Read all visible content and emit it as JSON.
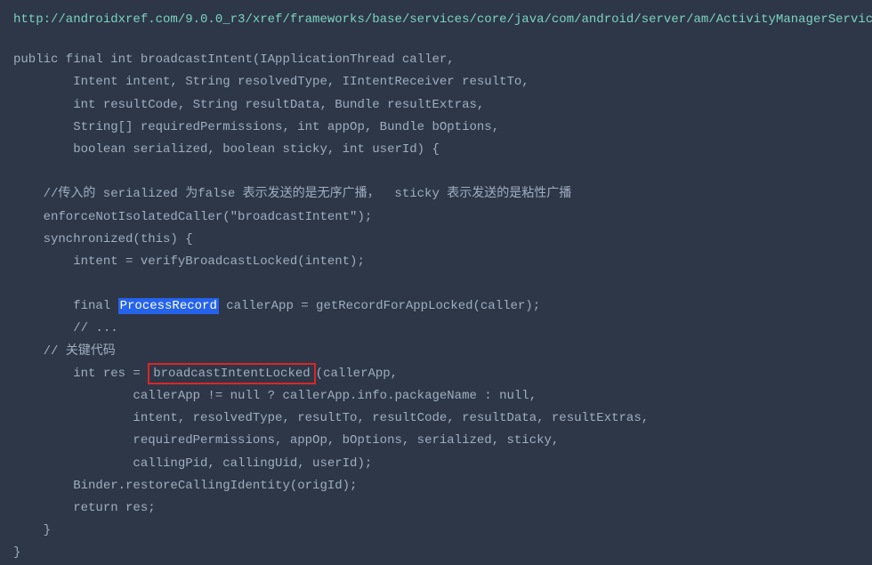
{
  "url": "http://androidxref.com/9.0.0_r3/xref/frameworks/base/services/core/java/com/android/server/am/ActivityManagerServic",
  "code": {
    "line1": "public final int broadcastIntent(IApplicationThread caller,",
    "line2": "        Intent intent, String resolvedType, IIntentReceiver resultTo,",
    "line3": "        int resultCode, String resultData, Bundle resultExtras,",
    "line4": "        String[] requiredPermissions, int appOp, Bundle bOptions,",
    "line5": "        boolean serialized, boolean sticky, int userId) {",
    "line6": "",
    "line7": "    //传入的 serialized 为false 表示发送的是无序广播，  sticky 表示发送的是粘性广播",
    "line8": "    enforceNotIsolatedCaller(\"broadcastIntent\");",
    "line9": "    synchronized(this) {",
    "line10": "        intent = verifyBroadcastLocked(intent);",
    "line11": "",
    "line12a": "        final ",
    "line12b": "ProcessRecord",
    "line12c": " callerApp = getRecordForAppLocked(caller);",
    "line13": "        // ...",
    "line14": "    // 关键代码",
    "line15a": "        int res = ",
    "line15b": "broadcastIntentLocked",
    "line15c": "(callerApp,",
    "line16": "                callerApp != null ? callerApp.info.packageName : null,",
    "line17": "                intent, resolvedType, resultTo, resultCode, resultData, resultExtras,",
    "line18": "                requiredPermissions, appOp, bOptions, serialized, sticky,",
    "line19": "                callingPid, callingUid, userId);",
    "line20": "        Binder.restoreCallingIdentity(origId);",
    "line21": "        return res;",
    "line22": "    }",
    "line23": "}"
  }
}
